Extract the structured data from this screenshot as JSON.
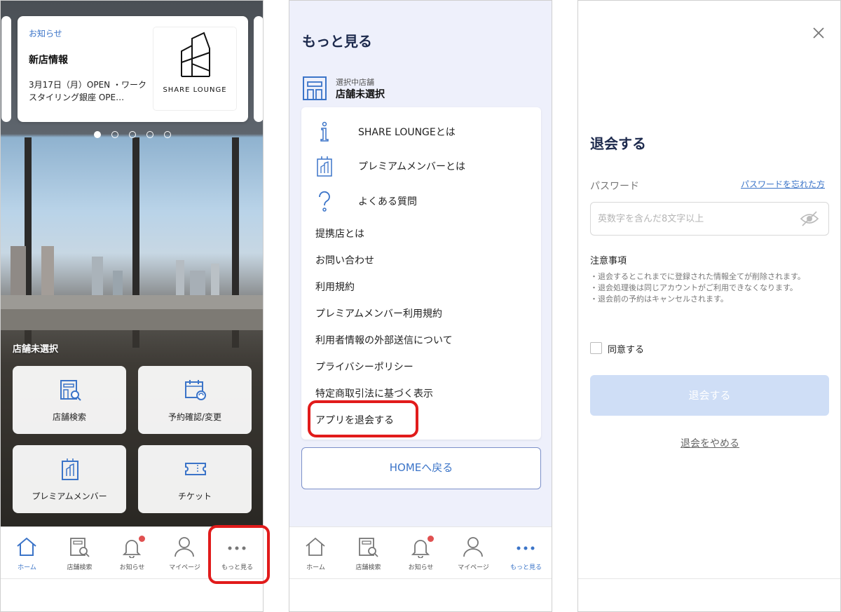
{
  "screen1": {
    "notice": {
      "category": "お知らせ",
      "title": "新店情報",
      "body": "3月17日（月）OPEN ・ワークスタイリング銀座 OPE…",
      "logo_text": "SHARE LOUNGE"
    },
    "store_status": "店舗未選択",
    "tiles": [
      {
        "label": "店舗検索",
        "icon": "store-search-icon"
      },
      {
        "label": "予約確認/変更",
        "icon": "calendar-refresh-icon"
      },
      {
        "label": "プレミアムメンバー",
        "icon": "member-card-icon"
      },
      {
        "label": "チケット",
        "icon": "ticket-icon"
      }
    ]
  },
  "tabbar": {
    "items": [
      {
        "label": "ホーム",
        "icon": "home-icon"
      },
      {
        "label": "店舗検索",
        "icon": "store-search-icon"
      },
      {
        "label": "お知らせ",
        "icon": "bell-icon"
      },
      {
        "label": "マイページ",
        "icon": "person-icon"
      },
      {
        "label": "もっと見る",
        "icon": "more-dots-icon"
      }
    ],
    "accent": "#3b74c8",
    "badge_color": "#e05050"
  },
  "screen2": {
    "title": "もっと見る",
    "store_caption": "選択中店舗",
    "store_value": "店舗未選択",
    "menu_items": [
      {
        "label": "SHARE LOUNGEとは",
        "icon": "info-icon"
      },
      {
        "label": "プレミアムメンバーとは",
        "icon": "member-card-icon"
      },
      {
        "label": "よくある質問",
        "icon": "question-icon"
      },
      {
        "label": "提携店とは"
      },
      {
        "label": "お問い合わせ"
      },
      {
        "label": "利用規約"
      },
      {
        "label": "プレミアムメンバー利用規約"
      },
      {
        "label": "利用者情報の外部送信について"
      },
      {
        "label": "プライバシーポリシー"
      },
      {
        "label": "特定商取引法に基づく表示"
      },
      {
        "label": "アプリを退会する"
      }
    ],
    "home_button": "HOMEへ戻る"
  },
  "screen3": {
    "title": "退会する",
    "password_label": "パスワード",
    "forgot_link": "パスワードを忘れた方",
    "password_placeholder": "英数字を含んだ8文字以上",
    "notes_title": "注意事項",
    "notes": [
      "・退会するとこれまでに登録された情報全てが削除されます。",
      "・退会処理後は同じアカウントがご利用できなくなります。",
      "・退会前の予約はキャンセルされます。"
    ],
    "agree_label": "同意する",
    "submit_button": "退会する",
    "cancel_link": "退会をやめる"
  }
}
